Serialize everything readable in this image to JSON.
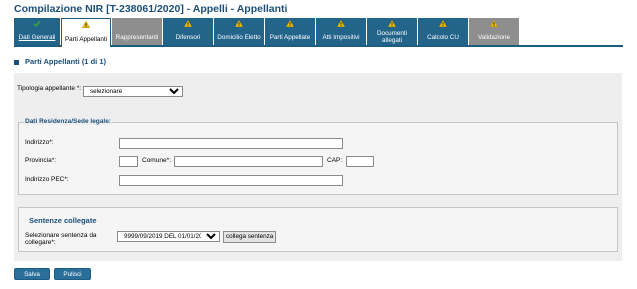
{
  "page": {
    "title": "Compilazione NIR [T-238061/2020] - Appelli - Appellanti"
  },
  "tabs": [
    {
      "label": "Dati Generali",
      "status_icon": "check-icon",
      "state": "done"
    },
    {
      "label": "Parti Appellanti",
      "status_icon": "warning-icon",
      "state": "active"
    },
    {
      "label": "Rappresentanti",
      "status_icon": "",
      "state": "disabled"
    },
    {
      "label": "Difensori",
      "status_icon": "warning-icon",
      "state": "normal"
    },
    {
      "label": "Domicilio Eletto",
      "status_icon": "warning-icon",
      "state": "normal"
    },
    {
      "label": "Parti Appellate",
      "status_icon": "warning-icon",
      "state": "normal"
    },
    {
      "label": "Atti Impositivi",
      "status_icon": "warning-icon",
      "state": "normal"
    },
    {
      "label": "Documenti allegati",
      "status_icon": "warning-icon",
      "state": "normal"
    },
    {
      "label": "Calcolo CU",
      "status_icon": "warning-icon",
      "state": "normal"
    },
    {
      "label": "Validazione",
      "status_icon": "warning-icon",
      "state": "disabled"
    }
  ],
  "section": {
    "title": "Parti Appellanti (1 di 1)"
  },
  "form": {
    "tipologia_label": "Tipologia appellante *:",
    "tipologia_value": "selezionare",
    "residenza_legend": "Dati Residenza/Sede legale:",
    "indirizzo_label": "Indirizzo*:",
    "indirizzo_value": "",
    "provincia_label": "Provincia*:",
    "provincia_value": "",
    "comune_label": "Comune*:",
    "comune_value": "",
    "cap_label": "CAP:",
    "cap_value": "",
    "pec_label": "Indirizzo PEC*:",
    "pec_value": ""
  },
  "sentenze": {
    "title": "Sentenze collegate",
    "select_label_line1": "Selezionare sentenza da",
    "select_label_line2": "collegare*:",
    "selected_value": "9999/09/2019 DEL 01/01/2019",
    "link_button": "collega sentenza"
  },
  "footer": {
    "save_label": "Salva",
    "clear_label": "Pulisci"
  },
  "colors": {
    "tab_blue": "#23648b",
    "tab_grey": "#8e8e8e",
    "heading_blue": "#1b4f7a",
    "warning_yellow": "#f2c200",
    "check_green": "#3aa13a"
  }
}
